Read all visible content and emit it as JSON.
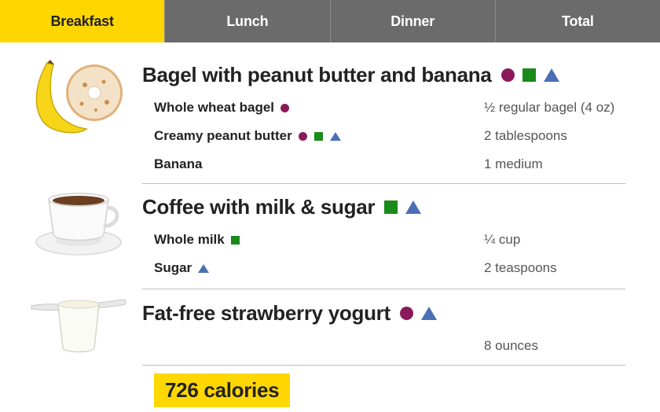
{
  "tabs": [
    {
      "label": "Breakfast",
      "active": true
    },
    {
      "label": "Lunch",
      "active": false
    },
    {
      "label": "Dinner",
      "active": false
    },
    {
      "label": "Total",
      "active": false
    }
  ],
  "colors": {
    "accent": "#ffd700",
    "tab_bg": "#6b6b6b",
    "marker_circle": "#8b1a5a",
    "marker_square": "#1a8a1a",
    "marker_triangle": "#4a6fb5"
  },
  "meal": {
    "items": [
      {
        "title": "Bagel with peanut butter and banana",
        "image_icon": "bagel-banana-image",
        "markers": [
          "circle",
          "square",
          "triangle"
        ],
        "ingredients": [
          {
            "name": "Whole wheat bagel",
            "markers": [
              "circle"
            ],
            "quantity": "½ regular bagel (4 oz)"
          },
          {
            "name": "Creamy peanut butter",
            "markers": [
              "circle",
              "square",
              "triangle"
            ],
            "quantity": "2 tablespoons"
          },
          {
            "name": "Banana",
            "markers": [],
            "quantity": "1 medium"
          }
        ]
      },
      {
        "title": "Coffee with milk & sugar",
        "image_icon": "coffee-cup-image",
        "markers": [
          "square",
          "triangle"
        ],
        "ingredients": [
          {
            "name": "Whole milk",
            "markers": [
              "square"
            ],
            "quantity": "¼ cup"
          },
          {
            "name": "Sugar",
            "markers": [
              "triangle"
            ],
            "quantity": "2 teaspoons"
          }
        ]
      },
      {
        "title": "Fat-free strawberry yogurt",
        "image_icon": "yogurt-cup-image",
        "markers": [
          "circle",
          "triangle"
        ],
        "ingredients": [
          {
            "name": "",
            "markers": [],
            "quantity": "8 ounces"
          }
        ]
      }
    ],
    "calories": "726 calories"
  }
}
